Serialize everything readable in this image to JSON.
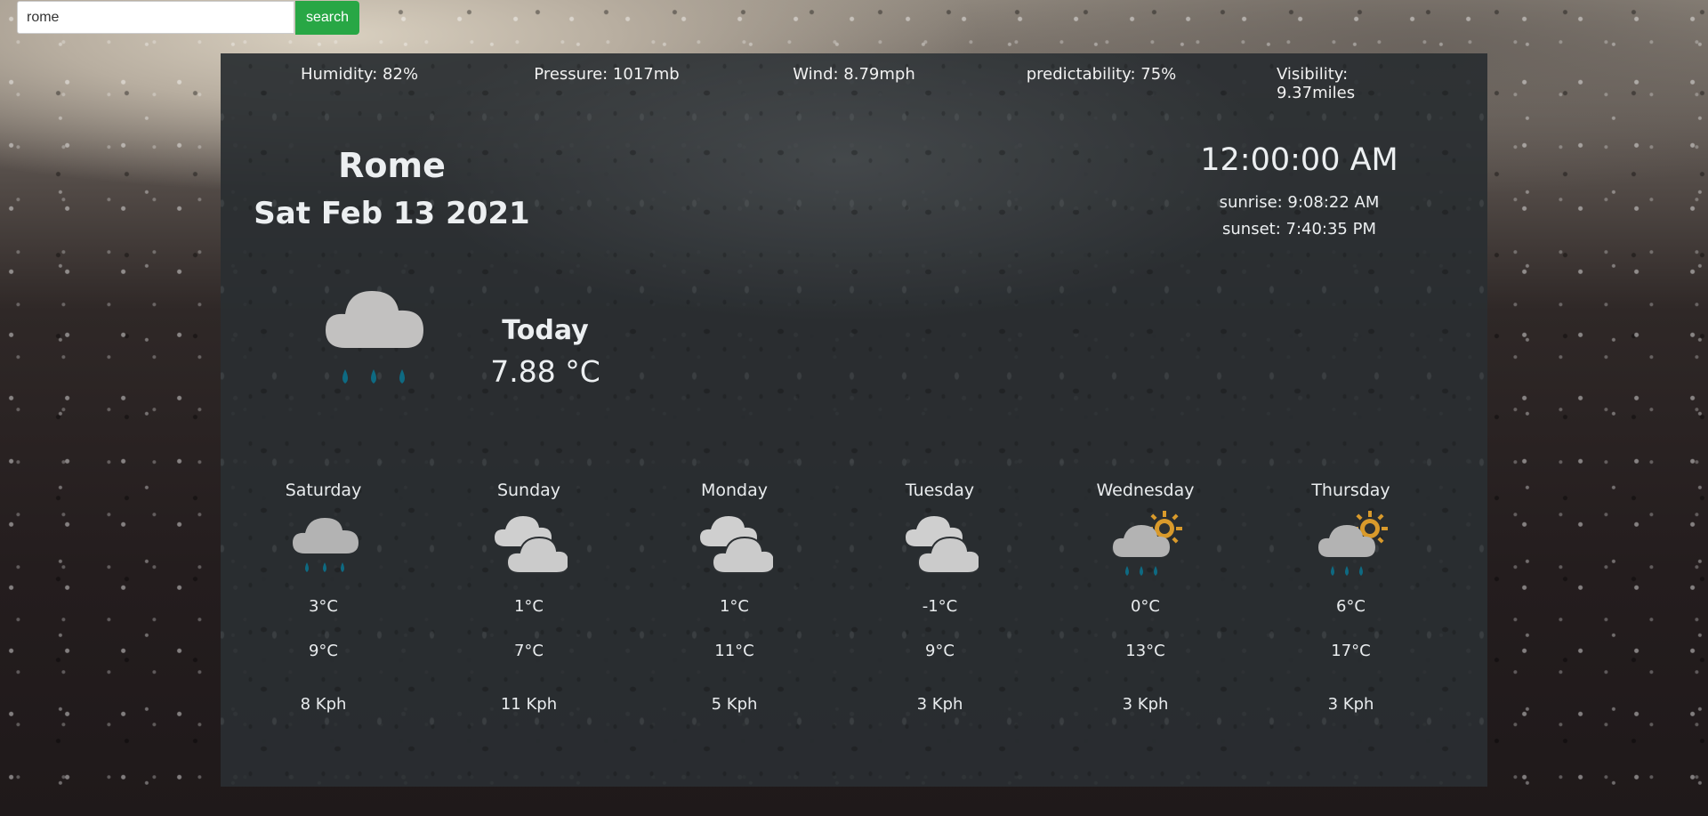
{
  "search": {
    "value": "rome",
    "placeholder": "",
    "button_label": "search"
  },
  "stats": [
    {
      "label": "Humidity: 82%"
    },
    {
      "label": "Pressure: 1017mb"
    },
    {
      "label": "Wind: 8.79mph"
    },
    {
      "label": "predictability: 75%"
    },
    {
      "label": "Visibility: 9.37miles"
    }
  ],
  "location": {
    "city": "Rome",
    "date": "Sat Feb 13 2021"
  },
  "time": {
    "clock": "12:00:00 AM",
    "sunrise": "sunrise: 9:08:22 AM",
    "sunset": "sunset: 7:40:35 PM"
  },
  "today": {
    "label": "Today",
    "temp": "7.88 °C",
    "icon": "rain-cloud-icon"
  },
  "forecast": [
    {
      "day": "Saturday",
      "icon": "rain-cloud-icon",
      "low": "3°C",
      "high": "9°C",
      "wind": "8 Kph"
    },
    {
      "day": "Sunday",
      "icon": "cloudy-icon",
      "low": "1°C",
      "high": "7°C",
      "wind": "11 Kph"
    },
    {
      "day": "Monday",
      "icon": "cloudy-icon",
      "low": "1°C",
      "high": "11°C",
      "wind": "5 Kph"
    },
    {
      "day": "Tuesday",
      "icon": "cloudy-icon",
      "low": "-1°C",
      "high": "9°C",
      "wind": "3 Kph"
    },
    {
      "day": "Wednesday",
      "icon": "sun-rain-cloud-icon",
      "low": "0°C",
      "high": "13°C",
      "wind": "3 Kph"
    },
    {
      "day": "Thursday",
      "icon": "sun-rain-cloud-icon",
      "low": "6°C",
      "high": "17°C",
      "wind": "3 Kph"
    }
  ],
  "colors": {
    "search_button": "#28a745",
    "panel": "#2a2e31",
    "raindrop": "#0e6a82",
    "sun": "#d99a2b",
    "cloud": "#bdbdbd"
  }
}
